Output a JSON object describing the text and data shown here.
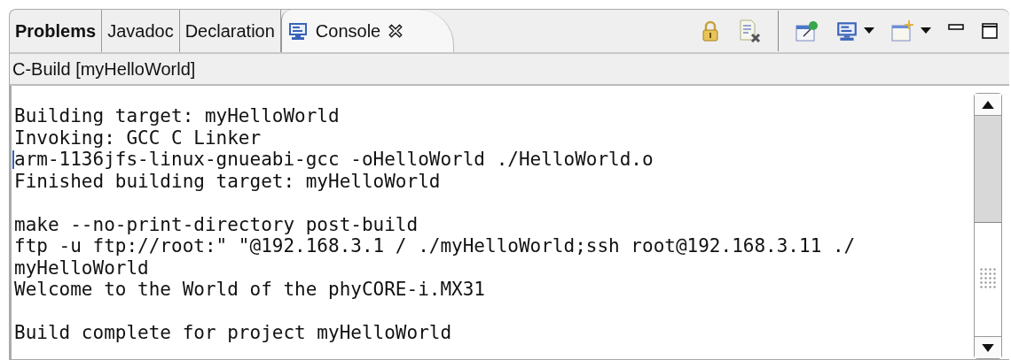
{
  "tabs": [
    {
      "label": "Problems",
      "selected": false,
      "bold": true,
      "kind": "text"
    },
    {
      "label": "Javadoc",
      "selected": false,
      "bold": false,
      "kind": "text"
    },
    {
      "label": "Declaration",
      "selected": false,
      "bold": false,
      "kind": "text"
    },
    {
      "label": "Console",
      "selected": true,
      "bold": false,
      "kind": "console",
      "closable": true
    }
  ],
  "toolbar": [
    {
      "kind": "lock"
    },
    {
      "kind": "clear"
    },
    {
      "kind": "separator"
    },
    {
      "kind": "pin"
    },
    {
      "kind": "display",
      "dropdown": true
    },
    {
      "kind": "open",
      "dropdown": true
    }
  ],
  "console_title": "C-Build [myHelloWorld]",
  "console_blocks": [
    [
      {
        "text": "Building target: myHelloWorld",
        "cursor": false
      },
      {
        "text": "Invoking: GCC C Linker",
        "cursor": false
      },
      {
        "text": "arm-1136jfs-linux-gnueabi-gcc -oHelloWorld ./HelloWorld.o",
        "cursor": true
      },
      {
        "text": "Finished building target: myHelloWorld",
        "cursor": false
      }
    ],
    [
      {
        "text": "make --no-print-directory post-build",
        "cursor": false
      },
      {
        "text": "ftp -u ftp://root:\" \"@192.168.3.1 / ./myHelloWorld;ssh root@192.168.3.11 ./",
        "cursor": false
      },
      {
        "text": "myHelloWorld",
        "cursor": false
      },
      {
        "text": "Welcome to the World of the phyCORE-i.MX31",
        "cursor": false
      }
    ],
    [
      {
        "text": "Build complete for project myHelloWorld",
        "cursor": false
      }
    ]
  ]
}
